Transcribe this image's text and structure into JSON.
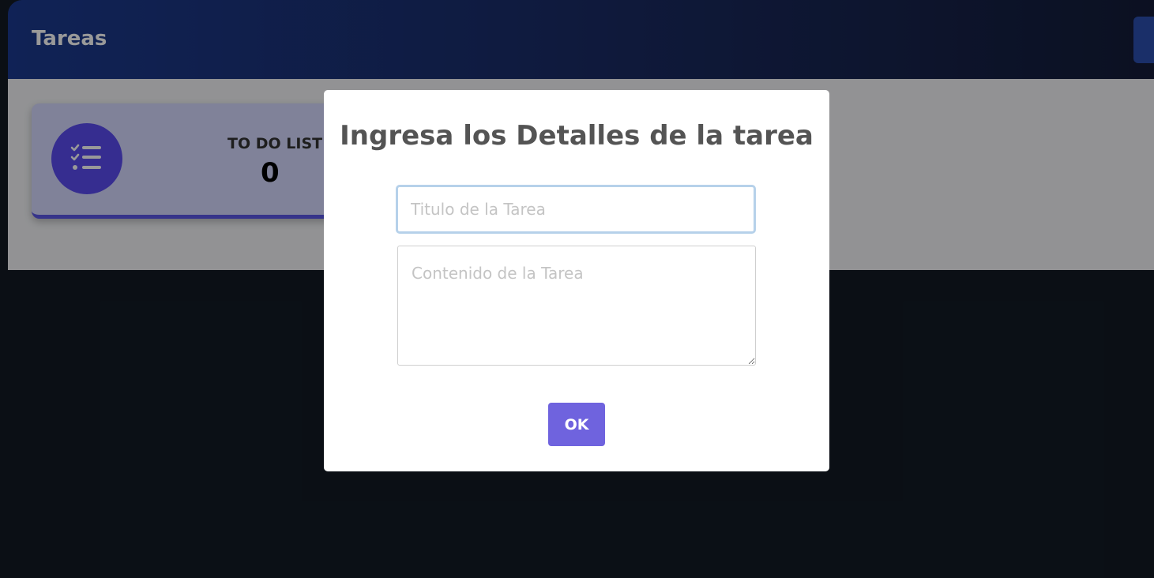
{
  "header": {
    "title": "Tareas"
  },
  "stats_card": {
    "label": "TO DO LIST",
    "count": "0",
    "icon": "checklist-icon"
  },
  "modal": {
    "title": "Ingresa los Detalles de la tarea",
    "title_input": {
      "placeholder": "Titulo de la Tarea",
      "value": ""
    },
    "content_input": {
      "placeholder": "Contenido de la Tarea",
      "value": ""
    },
    "ok_label": "OK"
  },
  "colors": {
    "accent": "#6f63de",
    "card_bg": "#d5d9ff",
    "card_border": "#5b58e6",
    "icon_circle": "#5a4cf0",
    "header_start": "#1b3a8f",
    "page_dark": "#131a24"
  }
}
